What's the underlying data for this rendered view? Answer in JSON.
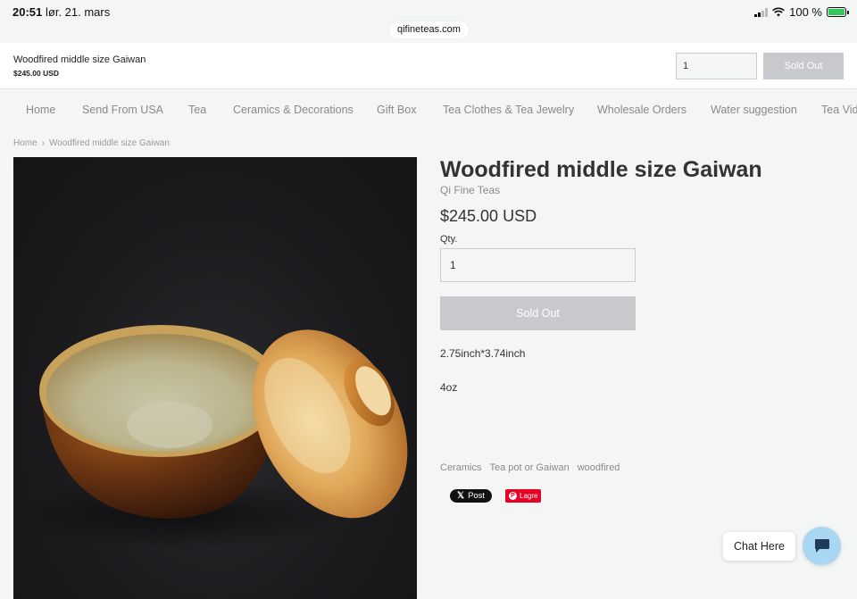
{
  "status_bar": {
    "time": "20:51",
    "date": "lør. 21. mars",
    "battery": "100 %",
    "url": "qifineteas.com"
  },
  "sticky_bar": {
    "title": "Woodfired middle size Gaiwan",
    "price": "$245.00 USD",
    "qty": "1",
    "sold_out": "Sold Out"
  },
  "nav": {
    "items": [
      "Home",
      "Send From USA",
      "Tea",
      "Ceramics & Decorations",
      "Gift Box",
      "Tea Clothes & Tea Jewelry",
      "Wholesale Orders",
      "Water suggestion",
      "Tea Vid"
    ]
  },
  "breadcrumb": {
    "home": "Home",
    "separator": "›",
    "current": "Woodfired middle size Gaiwan"
  },
  "product": {
    "title": "Woodfired middle size Gaiwan",
    "vendor": "Qi Fine Teas",
    "price": "$245.00 USD",
    "qty_label": "Qty.",
    "qty": "1",
    "sold_out": "Sold Out",
    "desc_size": "2.75inch*3.74inch",
    "desc_volume": "4oz",
    "tags": [
      "Ceramics",
      "Tea pot or Gaiwan",
      "woodfired"
    ]
  },
  "social": {
    "x_post": "Post",
    "pin_save": "Lagre"
  },
  "chat": {
    "label": "Chat Here"
  },
  "colors": {
    "page_bg": "#f4f5f5",
    "sold_out_bg": "#c8c9cc",
    "chat_button": "#a9d7f3",
    "pinterest": "#e60023",
    "x_black": "#111111"
  }
}
